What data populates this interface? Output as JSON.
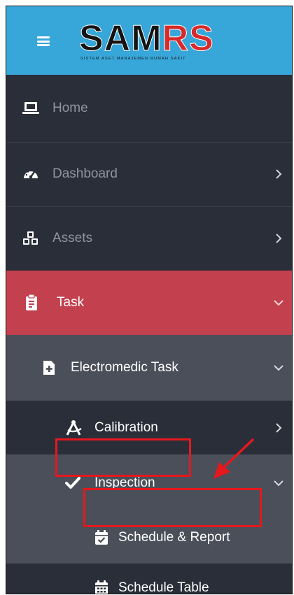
{
  "header": {
    "logo": {
      "part1": "SAM",
      "part2": "RS",
      "subtitle": "SISTEM ASET MANAJEMEN RUMAH SAKIT"
    },
    "menu_icon": "hamburger-icon"
  },
  "menu": {
    "home": {
      "label": "Home",
      "icon": "laptop-icon"
    },
    "dashboard": {
      "label": "Dashboard",
      "icon": "tachometer-icon"
    },
    "assets": {
      "label": "Assets",
      "icon": "cubes-icon"
    },
    "task": {
      "label": "Task",
      "icon": "clipboard-icon"
    },
    "electromedic_task": {
      "label": "Electromedic Task",
      "icon": "file-medical-icon"
    },
    "calibration": {
      "label": "Calibration",
      "icon": "compass-drafting-icon"
    },
    "inspection": {
      "label": "Inspection",
      "icon": "check-icon"
    },
    "schedule_report": {
      "label": "Schedule & Report",
      "icon": "calendar-check-icon"
    },
    "schedule_table": {
      "label": "Schedule Table",
      "icon": "calendar-icon"
    }
  },
  "colors": {
    "header": "#37a6d8",
    "sidebar": "#2a2e38",
    "active": "#c3404f",
    "submenu": "#4b4f59",
    "highlight": "#e5181e"
  }
}
